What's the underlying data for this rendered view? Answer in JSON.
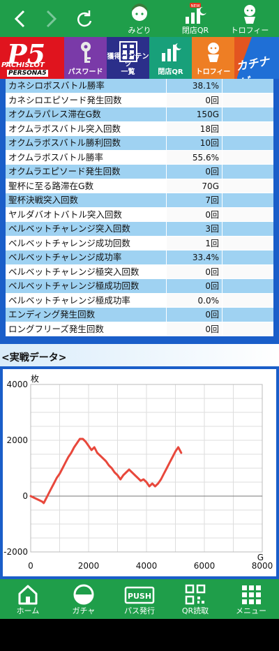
{
  "topbar": {
    "items": [
      {
        "label": "みどり"
      },
      {
        "label": "閉店QR",
        "badge": "NEW"
      },
      {
        "label": "トロフィー"
      }
    ]
  },
  "categories": {
    "logo_main": "P5",
    "logo_sub": "PACHISLOT",
    "logo_sub2": "PERSONA5",
    "pass": "パスワード",
    "content_1": "獲得コンテンツ",
    "content_2": "一覧",
    "qr": "閉店QR",
    "trophy": "トロフィー",
    "game_box": "P5",
    "kachi": "カチナビ"
  },
  "stats": [
    {
      "label": "カネシロボスバトル勝率",
      "value": "38.1%"
    },
    {
      "label": "カネシロエピソード発生回数",
      "value": "0回"
    },
    {
      "label": "オクムラパレス滞在G数",
      "value": "150G"
    },
    {
      "label": "オクムラボスバトル突入回数",
      "value": "18回"
    },
    {
      "label": "オクムラボスバトル勝利回数",
      "value": "10回"
    },
    {
      "label": "オクムラボスバトル勝率",
      "value": "55.6%"
    },
    {
      "label": "オクムラエピソード発生回数",
      "value": "0回"
    },
    {
      "label": "聖杯に至る路滞在G数",
      "value": "70G"
    },
    {
      "label": "聖杯決戦突入回数",
      "value": "7回"
    },
    {
      "label": "ヤルダバオトバトル突入回数",
      "value": "0回"
    },
    {
      "label": "ベルベットチャレンジ突入回数",
      "value": "3回"
    },
    {
      "label": "ベルベットチャレンジ成功回数",
      "value": "1回"
    },
    {
      "label": "ベルベットチャレンジ成功率",
      "value": "33.4%"
    },
    {
      "label": "ベルベットチャレンジ極突入回数",
      "value": "0回"
    },
    {
      "label": "ベルベットチャレンジ極成功回数",
      "value": "0回"
    },
    {
      "label": "ベルベットチャレンジ極成功率",
      "value": "0.0%"
    },
    {
      "label": "エンディング発生回数",
      "value": "0回"
    },
    {
      "label": "ロングフリーズ発生回数",
      "value": "0回"
    }
  ],
  "section_title": "<実戦データ>",
  "chart_data": {
    "type": "line",
    "ylabel": "枚",
    "xlabel": "G",
    "xlim": [
      0,
      8000
    ],
    "ylim": [
      -2000,
      4000
    ],
    "xticks": [
      "0",
      "2000",
      "4000",
      "6000",
      "8000"
    ],
    "yticks": [
      "4000",
      "2000",
      "0",
      "-2000"
    ],
    "grid": true,
    "color": "#e8483c",
    "series": [
      {
        "x": [
          0,
          100,
          200,
          300,
          400,
          450,
          500,
          600,
          700,
          800,
          900,
          1000,
          1100,
          1200,
          1300,
          1400,
          1500,
          1600,
          1700,
          1800,
          1900,
          2000,
          2100,
          2200,
          2300,
          2400,
          2500,
          2600,
          2700,
          2800,
          2900,
          3000,
          3100,
          3200,
          3300,
          3400,
          3500,
          3600,
          3700,
          3800,
          3900,
          4000,
          4100,
          4200,
          4300,
          4400,
          4500,
          4600,
          4700,
          4800,
          4900,
          5000,
          5100,
          5200
        ],
        "y": [
          0,
          -50,
          -100,
          -150,
          -200,
          -250,
          -150,
          50,
          250,
          450,
          650,
          800,
          1000,
          1200,
          1400,
          1550,
          1750,
          1900,
          2050,
          2050,
          1950,
          1800,
          1650,
          1750,
          1550,
          1450,
          1350,
          1250,
          1100,
          1000,
          850,
          750,
          600,
          750,
          850,
          950,
          850,
          750,
          650,
          550,
          600,
          500,
          350,
          450,
          350,
          450,
          600,
          800,
          1000,
          1200,
          1400,
          1600,
          1750,
          1550
        ]
      }
    ]
  },
  "bottombar": {
    "items": [
      {
        "label": "ホーム"
      },
      {
        "label": "ガチャ"
      },
      {
        "label": "パス発行",
        "icon_text": "PUSH"
      },
      {
        "label": "QR読取"
      },
      {
        "label": "メニュー"
      }
    ]
  }
}
